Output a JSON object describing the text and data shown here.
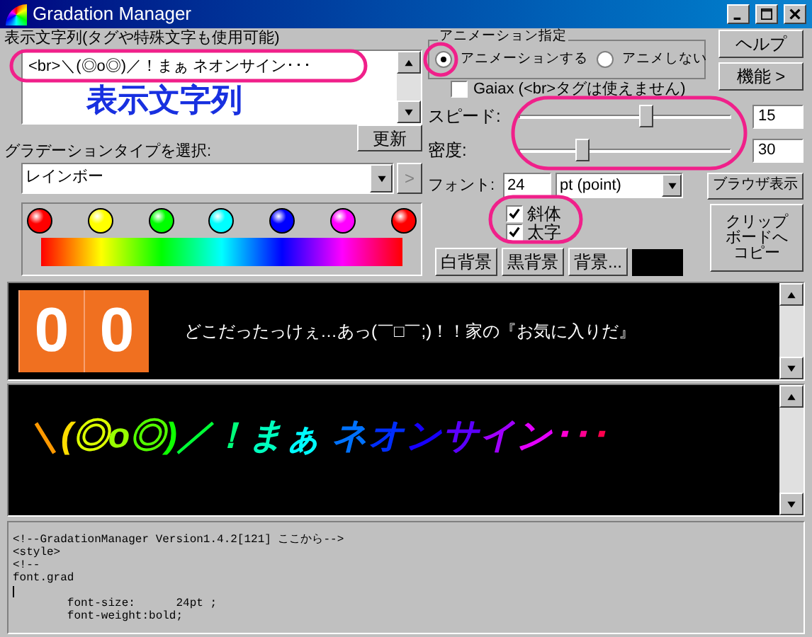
{
  "window": {
    "title": "Gradation Manager"
  },
  "display_text": {
    "label": "表示文字列(タグや特殊文字も使用可能)",
    "value": "<br>＼(◎o◎)／！まぁ ネオンサイン･･･"
  },
  "update_button": "更新",
  "gradation": {
    "label": "グラデーションタイプを選択:",
    "value": "レインボー",
    "next_button": ">",
    "stops": [
      {
        "color": "#ff0000"
      },
      {
        "color": "#ffff00"
      },
      {
        "color": "#00ff00"
      },
      {
        "color": "#00ffff"
      },
      {
        "color": "#0000ff"
      },
      {
        "color": "#ff00ff"
      },
      {
        "color": "#ff0000"
      }
    ]
  },
  "animation": {
    "title": "アニメーション指定",
    "options": [
      {
        "label": "アニメーションする",
        "selected": true
      },
      {
        "label": "アニメしない",
        "selected": false
      }
    ]
  },
  "gaiax": {
    "label": "Gaiax (<br>タグは使えません)",
    "checked": false
  },
  "sliders": [
    {
      "label": "スピード:",
      "level": 0.6,
      "value": "15"
    },
    {
      "label": "密度:",
      "level": 0.3,
      "value": "30"
    }
  ],
  "font": {
    "label": "フォント:",
    "size": "24",
    "unit": "pt (point)"
  },
  "styles": [
    {
      "label": "斜体",
      "checked": true
    },
    {
      "label": "太字",
      "checked": true
    }
  ],
  "buttons": {
    "help": "ヘルプ",
    "features": "機能 >",
    "browser": "ブラウザ表示",
    "clipboard": "クリップボードへコピー"
  },
  "background_buttons": [
    "白背景",
    "黒背景",
    "背景..."
  ],
  "background_swatch": {
    "color": "#000000"
  },
  "ticker": {
    "counter": [
      "0",
      "0"
    ],
    "text": "どこだったっけぇ…あっ(￣□￣;)！！家の『お気に入りだ』"
  },
  "preview": {
    "text": "＼(◎o◎)／！まぁ ネオンサイン･･･"
  },
  "code": {
    "lines": [
      {
        "kind": "text",
        "text": "<!--GradationManager Version1.4.2[121] ここから-->"
      },
      {
        "kind": "text",
        "text": "<style>"
      },
      {
        "kind": "text",
        "text": "<!--"
      },
      {
        "kind": "text",
        "text": "font.grad"
      },
      {
        "kind": "caret"
      },
      {
        "kind": "text",
        "text": "        font-size:      24pt ;"
      },
      {
        "kind": "text",
        "text": "        font-weight:bold;"
      }
    ]
  },
  "annotation": {
    "label": "表示文字列"
  }
}
